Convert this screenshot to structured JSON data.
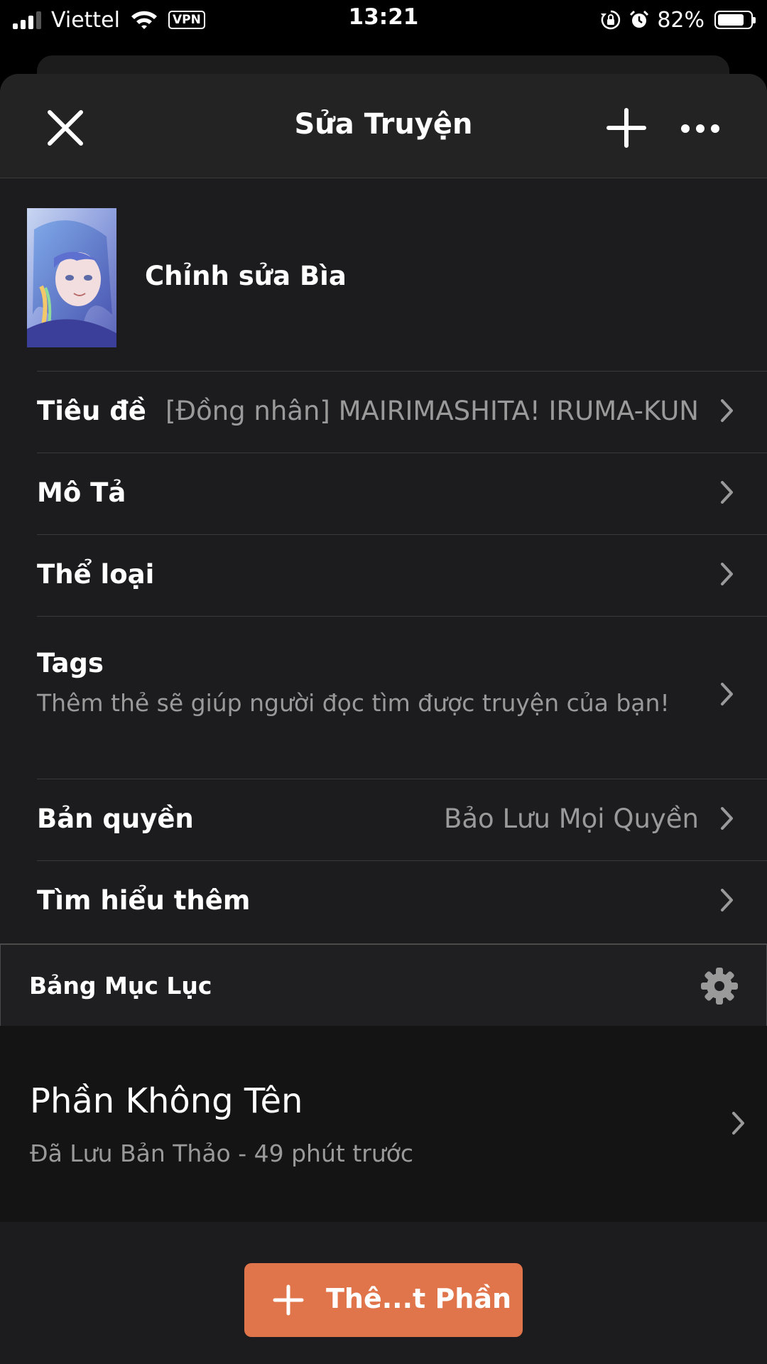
{
  "status_bar": {
    "carrier": "Viettel",
    "vpn": "VPN",
    "time": "13:21",
    "battery_percent": "82%",
    "battery_level": 0.82,
    "icons": [
      "signal-icon",
      "wifi-icon",
      "orientation-lock-icon",
      "alarm-icon",
      "battery-icon"
    ]
  },
  "header": {
    "title": "Sửa Truyện",
    "close_icon": "close-icon",
    "add_icon": "plus-icon",
    "more_icon": "more-icon"
  },
  "cover": {
    "label": "Chỉnh sửa Bìa"
  },
  "fields": {
    "title": {
      "label": "Tiêu đề",
      "value": "[Đồng nhân] MAIRIMASHITA! IRUMA-KUN"
    },
    "description": {
      "label": "Mô Tả"
    },
    "genre": {
      "label": "Thể loại"
    },
    "tags": {
      "label": "Tags",
      "hint": "Thêm thẻ sẽ giúp người đọc tìm được truyện của bạn!"
    },
    "copyright": {
      "label": "Bản quyền",
      "value": "Bảo Lưu Mọi Quyền"
    },
    "learn_more": {
      "label": "Tìm hiểu thêm"
    }
  },
  "toc": {
    "label": "Bảng Mục Lục"
  },
  "parts": [
    {
      "title": "Phần Không Tên",
      "status": "Đã Lưu Bản Thảo - 49 phút trước"
    }
  ],
  "add_part_button": {
    "label": "Thê...t Phần"
  },
  "colors": {
    "background": "#1c1c1e",
    "accent": "#e0744a",
    "secondary_text": "#9a9a9a"
  }
}
